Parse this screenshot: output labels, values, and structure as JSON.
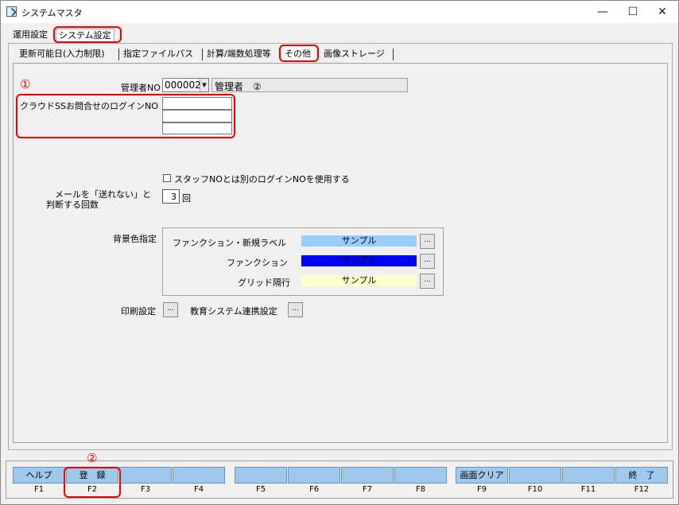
{
  "window": {
    "title": "システムマスタ",
    "controls": {
      "minimize": "—",
      "maximize": "☐",
      "close": "✕"
    }
  },
  "outer_tabs": [
    "運用設定",
    "システム設定"
  ],
  "inner_tabs": [
    "更新可能日(入力制限)",
    "指定ファイルパス",
    "計算/端数処理等",
    "その他",
    "画像ストレージ"
  ],
  "annotations": {
    "marker1": "①",
    "marker2": "②"
  },
  "form": {
    "admin_no_label": "管理者NO",
    "admin_no_value": "000002",
    "admin_name": "管理者　②",
    "cloud_login_label": "クラウドSSお問合せのログインNO",
    "staff_login_checkbox": "スタッフNOとは別のログインNOを使用する",
    "staff_login_checked": false,
    "mail_fail_label_1": "メールを「送れない」と",
    "mail_fail_label_2": "判断する回数",
    "mail_fail_count": "3",
    "mail_fail_unit": "回",
    "bg_color_label": "背景色指定",
    "bg_rows": [
      {
        "label": "ファンクション・新規ラベル",
        "sample": "サンプル",
        "color": "#99ccff",
        "text_color": "#000000"
      },
      {
        "label": "ファンクション",
        "sample": "サンプル",
        "color": "#0000ff",
        "text_color": "#000000"
      },
      {
        "label": "グリッド隔行",
        "sample": "サンプル",
        "color": "#ffffcc",
        "text_color": "#000000"
      }
    ],
    "ellipsis": "...",
    "print_label": "印刷設定",
    "edu_label": "教育システム連携設定"
  },
  "function_keys": [
    {
      "label": "ヘルプ",
      "key": "F1"
    },
    {
      "label": "登　録",
      "key": "F2"
    },
    {
      "label": "",
      "key": "F3"
    },
    {
      "label": "",
      "key": "F4"
    },
    {
      "label": "",
      "key": "F5"
    },
    {
      "label": "",
      "key": "F6"
    },
    {
      "label": "",
      "key": "F7"
    },
    {
      "label": "",
      "key": "F8"
    },
    {
      "label": "画面クリア",
      "key": "F9"
    },
    {
      "label": "",
      "key": "F10"
    },
    {
      "label": "",
      "key": "F11"
    },
    {
      "label": "終　了",
      "key": "F12"
    }
  ],
  "colors": {
    "fkey_bg": "#9ec8ec",
    "highlight": "#ee0000"
  }
}
